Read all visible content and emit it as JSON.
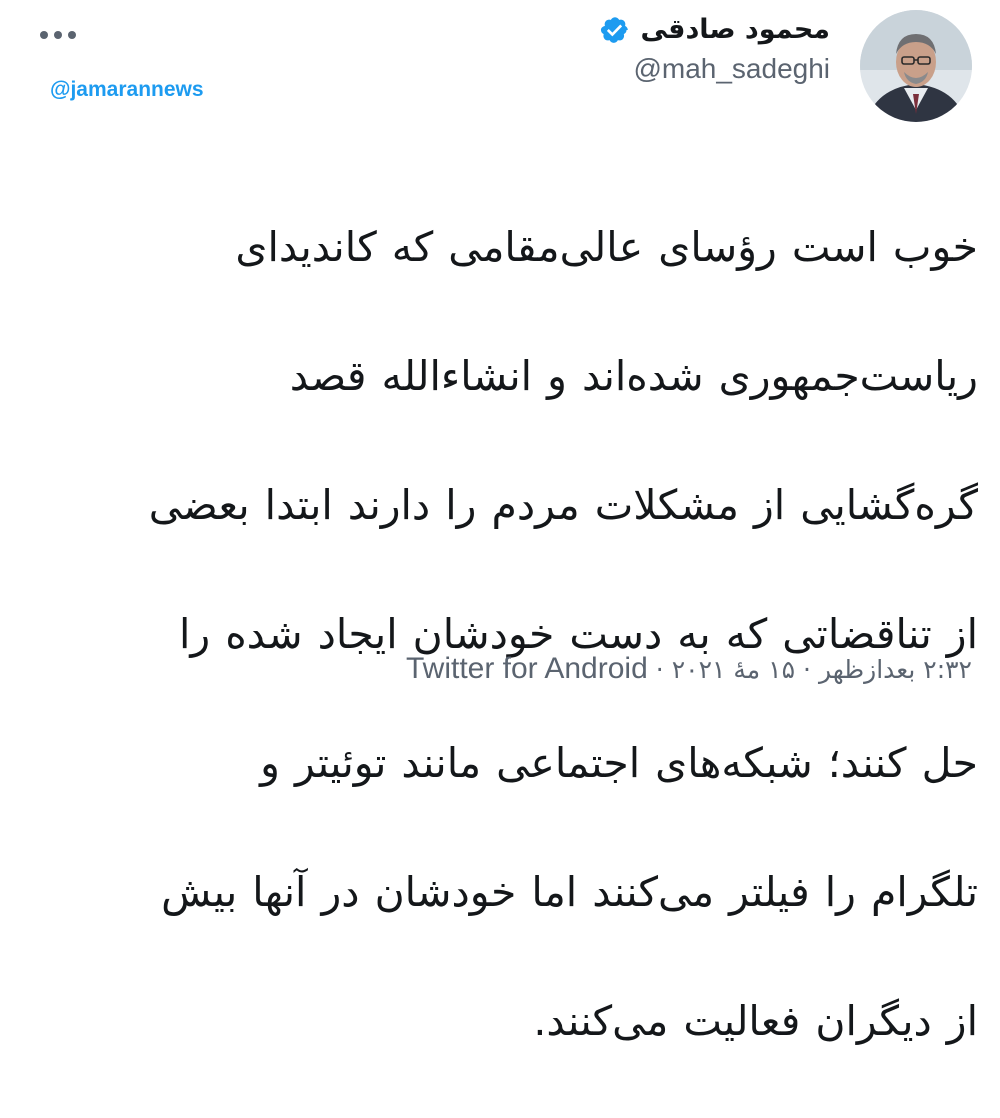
{
  "tweet": {
    "author": {
      "display_name": "محمود صادقی",
      "handle": "@mah_sadeghi",
      "verified": true,
      "verified_icon": "verified-badge-icon",
      "avatar": "avatar-photo"
    },
    "watermark": "@jamarannews",
    "more_icon": "more-options-icon",
    "text_lines": [
      "خوب است رؤسای عالی‌مقامی که کاندیدای",
      "ریاست‌جمهوری شده‌اند و انشاءالله قصد",
      "گره‌گشایی از مشکلات مردم را دارند ابتدا بعضی",
      "از تناقضاتی که به دست خودشان ایجاد شده را",
      "حل کنند؛ شبکه‌های اجتماعی مانند توئیتر و",
      "تلگرام را فیلتر می‌کنند اما خودشان در آنها بیش",
      "از دیگران فعالیت می‌کنند."
    ],
    "meta": {
      "time": "۲:۳۲ بعدازظهر",
      "date": "۱۵ مهٔ ۲۰۲۱",
      "separator": "·",
      "source": "Twitter for Android"
    }
  },
  "colors": {
    "text": "#14171a",
    "secondary": "#5b6470",
    "accent": "#1d9bf0",
    "background": "#ffffff"
  }
}
